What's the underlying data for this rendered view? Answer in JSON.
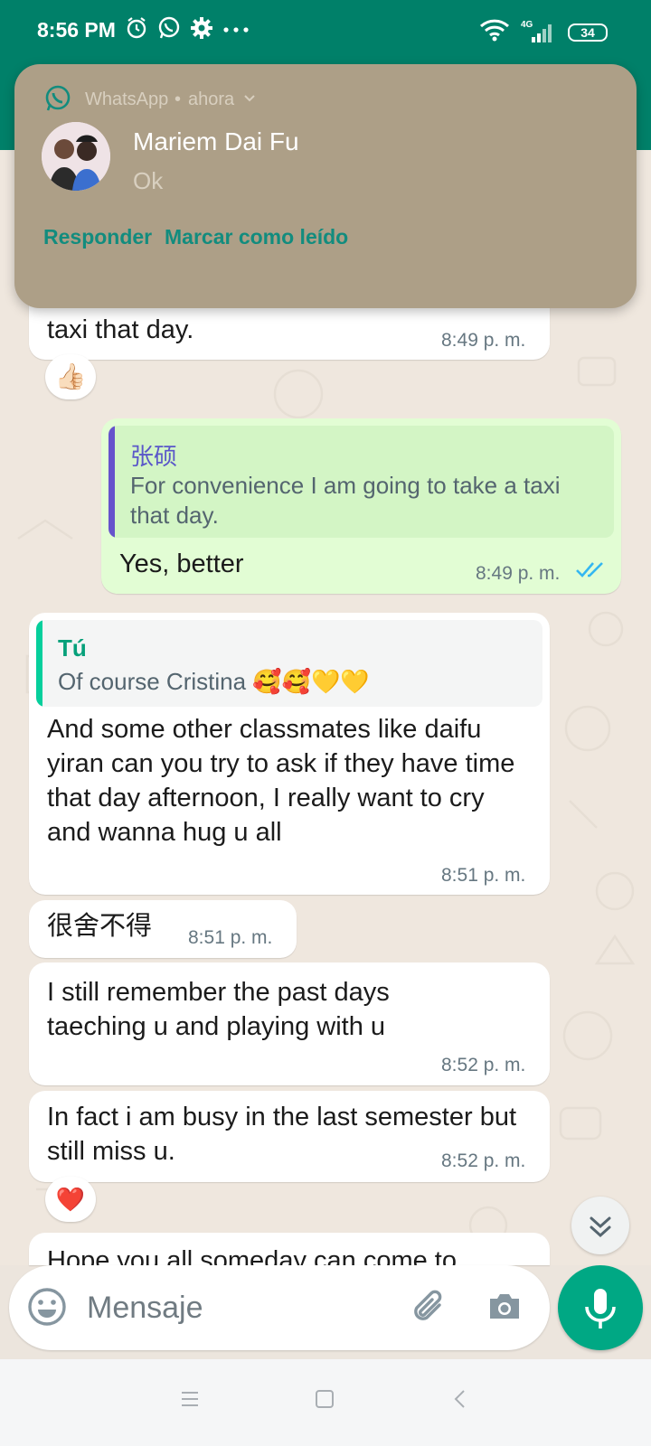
{
  "status_bar": {
    "time": "8:56 PM",
    "network": "4G",
    "battery": "34"
  },
  "notification": {
    "app_name": "WhatsApp",
    "separator": "•",
    "time": "ahora",
    "title": "Mariem Dai Fu",
    "body": "Ok",
    "actions": [
      "Responder",
      "Marcar como leído"
    ]
  },
  "messages": [
    {
      "text": "taxi that  day.",
      "time": "8:49 p. m.",
      "reaction": "👍🏻"
    },
    {
      "quote_author": "张硕",
      "quote_text": "For convenience I am going to take a taxi that  day.",
      "text": "Yes, better",
      "time": "8:49 p. m."
    },
    {
      "quote_author": "Tú",
      "quote_text": "Of course Cristina 🥰🥰💛💛",
      "text": "And some other classmates like daifu yiran can you try to ask if they have time that day afternoon, I really want to cry and wanna hug u all",
      "time": "8:51 p. m."
    },
    {
      "text": "很舍不得",
      "time": "8:51 p. m."
    },
    {
      "text": "I still remember the past days taeching u and playing with u",
      "time": "8:52 p. m."
    },
    {
      "text": "In fact i am busy in the last semester but still miss u.",
      "time": "8:52 p. m.",
      "reaction": "❤️"
    },
    {
      "text": "Hope you all someday can come to"
    }
  ],
  "input": {
    "placeholder": "Mensaje"
  },
  "colors": {
    "header": "#008069",
    "outgoing": "#e2fdd4",
    "accent": "#00a884",
    "read_ticks": "#34b7f1"
  },
  "icons": [
    "alarm-icon",
    "whatsapp-icon",
    "gear-icon",
    "more-dots-icon",
    "wifi-icon",
    "signal-icon",
    "emoji-icon",
    "attach-icon",
    "camera-icon",
    "mic-icon",
    "scroll-down-icon",
    "menu-icon",
    "home-icon",
    "back-icon"
  ]
}
